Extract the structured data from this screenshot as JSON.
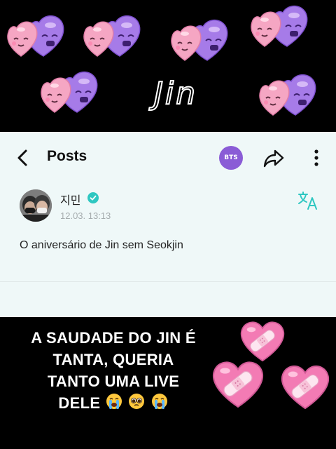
{
  "overlay_title": "Jin",
  "app_bar": {
    "title": "Posts",
    "group_badge": "BTS"
  },
  "post": {
    "author": "지민",
    "timestamp": "12.03. 13:13",
    "text": "O aniversário de Jin sem Seokjin"
  },
  "caption": {
    "lines": [
      "A SAUDADE DO JIN É",
      "TANTA, QUERIA",
      "TANTO UMA LIVE",
      "DELE"
    ],
    "emojis": [
      "loudly-crying-face",
      "pleading-face",
      "loudly-crying-face"
    ]
  },
  "colors": {
    "background": "#000000",
    "panel": "#eff8f8",
    "brand_purple": "#8a5cd6",
    "verified_teal": "#2ec7c1",
    "sticker_pink": "#f5a6c3",
    "sticker_purple": "#a67be8",
    "bandaid_heart": "#f37bb4"
  }
}
